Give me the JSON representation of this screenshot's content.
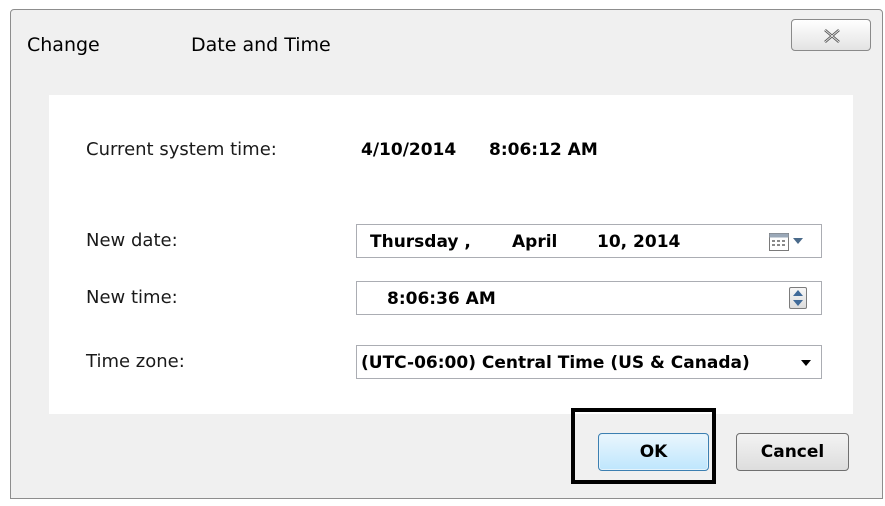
{
  "dialog": {
    "title_part1": "Change",
    "title_part2": "Date and Time"
  },
  "current_time": {
    "label": "Current system time:",
    "date": "4/10/2014",
    "time": "8:06:12 AM"
  },
  "new_date": {
    "label": "New date:",
    "weekday": "Thursday ,",
    "month": "April",
    "day_year": "10, 2014"
  },
  "new_time": {
    "label": "New time:",
    "value": "8:06:36 AM"
  },
  "time_zone": {
    "label": "Time zone:",
    "selected": "(UTC-06:00) Central Time (US & Canada)"
  },
  "buttons": {
    "ok": "OK",
    "cancel": "Cancel"
  },
  "icons": {
    "close": "close-icon",
    "calendar": "calendar-icon",
    "spinner": "spinner-icon",
    "dropdown": "chevron-down-icon"
  },
  "colors": {
    "ok_border": "#3c7fb1",
    "highlight": "#000000"
  }
}
